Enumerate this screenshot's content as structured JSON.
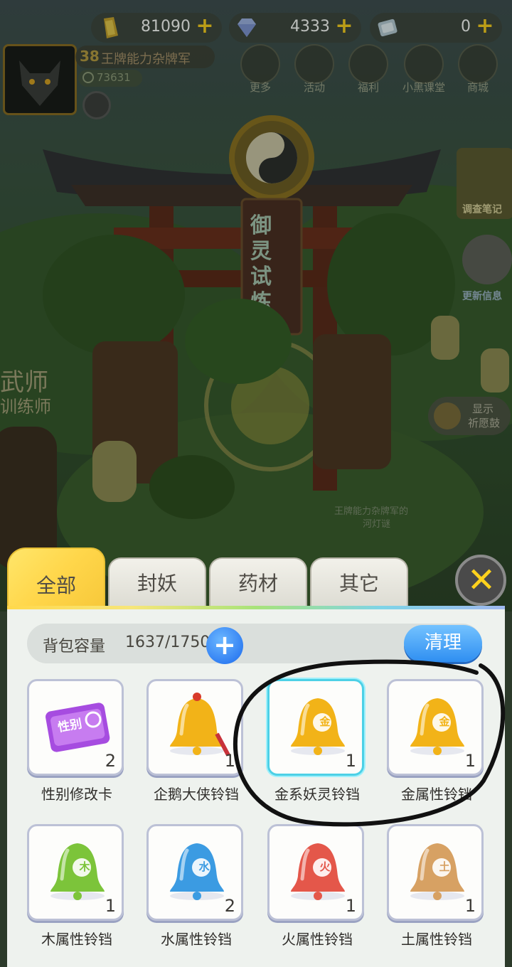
{
  "currencies": [
    {
      "name": "gold-ingot-icon",
      "value": "81090"
    },
    {
      "name": "diamond-icon",
      "value": "4333"
    },
    {
      "name": "crystal-ticket-icon",
      "value": "0"
    }
  ],
  "player": {
    "level": "38",
    "name": "王牌能力杂牌军",
    "power": "73631"
  },
  "menu": [
    {
      "label": "更多",
      "icon": "more-icon"
    },
    {
      "label": "活动",
      "icon": "event-icon"
    },
    {
      "label": "福利",
      "icon": "gift-icon"
    },
    {
      "label": "小黑课堂",
      "icon": "classroom-icon"
    },
    {
      "label": "商城",
      "icon": "shop-icon"
    }
  ],
  "scene": {
    "gate_sign": "御灵试炼",
    "npc_title": "武师",
    "npc_subtitle": "训练师",
    "side_notes": "调查笔记",
    "side_news": "更新信息",
    "wish_show": "显示",
    "wish_label": "祈愿鼓",
    "lantern_text": "王牌能力杂牌军的",
    "lantern_text2": "河灯谜"
  },
  "bag": {
    "tabs": [
      "全部",
      "封妖",
      "药材",
      "其它"
    ],
    "active_tab": 0,
    "capacity_label": "背包容量",
    "capacity_value": "1637/1750",
    "clean_label": "清理",
    "items": [
      {
        "label": "性别修改卡",
        "count": "2",
        "icon": "gender-card-icon",
        "color": "#a64ce0",
        "badge": "性别"
      },
      {
        "label": "企鹅大侠铃铛",
        "count": "1",
        "icon": "penguin-bell-icon",
        "color": "#f2b318",
        "badge": ""
      },
      {
        "label": "金系妖灵铃铛",
        "count": "1",
        "icon": "gold-spirit-bell-icon",
        "color": "#f2b318",
        "badge": "金"
      },
      {
        "label": "金属性铃铛",
        "count": "1",
        "icon": "metal-bell-icon",
        "color": "#f2b318",
        "badge": "金"
      },
      {
        "label": "木属性铃铛",
        "count": "1",
        "icon": "wood-bell-icon",
        "color": "#7cc43a",
        "badge": "木"
      },
      {
        "label": "水属性铃铛",
        "count": "2",
        "icon": "water-bell-icon",
        "color": "#3b9be2",
        "badge": "水"
      },
      {
        "label": "火属性铃铛",
        "count": "1",
        "icon": "fire-bell-icon",
        "color": "#e4574a",
        "badge": "火"
      },
      {
        "label": "土属性铃铛",
        "count": "1",
        "icon": "earth-bell-icon",
        "color": "#d7a163",
        "badge": "土"
      }
    ]
  }
}
